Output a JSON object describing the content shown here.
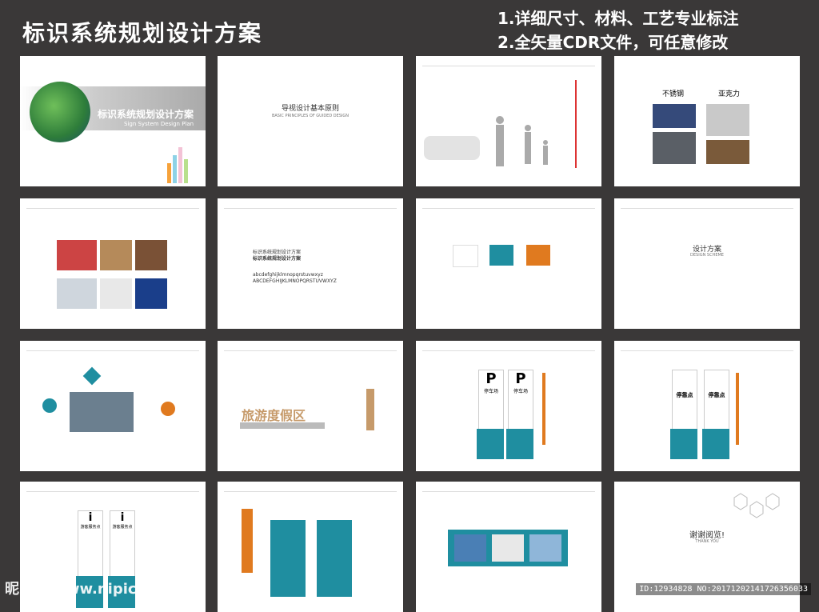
{
  "header": {
    "title": "标识系统规划设计方案",
    "note1": "1.详细尺寸、材料、工艺专业标注",
    "note2": "2.全矢量CDR文件，可任意修改"
  },
  "pages": {
    "p1": {
      "title_cn": "标识系统规划设计方案",
      "title_en": "Sign System Design Plan"
    },
    "p2": {
      "title_cn": "导视设计基本原则",
      "title_en": "BASIC PRINCIPLES OF GUIDED DESIGN"
    },
    "p4": {
      "label1": "不锈钢",
      "label2": "亚克力"
    },
    "p6": {
      "line1": "标识系统规划设计方案",
      "line2": "标识系统规划设计方案",
      "alphabet1": "abcdefghijklmnopqrstuvwxyz",
      "alphabet2": "ABCDEFGHIJKLMNOPQRSTUVWXYZ"
    },
    "p8": {
      "title_cn": "设计方案",
      "title_en": "DESIGN SCHEME"
    },
    "p10": {
      "logo_text": "旅游度假区"
    },
    "p11": {
      "sign1": "停车场",
      "sign2": "停车场"
    },
    "p12": {
      "sign1": "停靠点",
      "sign2": "停靠点"
    },
    "p13": {
      "sign1": "游客服务点",
      "sign2": "游客服务点"
    },
    "p16": {
      "title_cn": "谢谢阅览!",
      "title_en": "THANK YOU"
    }
  },
  "footer": {
    "watermark": "昵图网 www.nipic.com",
    "id_text": "ID:12934828 NO:20171202141726356033"
  },
  "colors": {
    "teal": "#1f8ea0",
    "orange": "#e07a1f",
    "background": "#3a3838"
  }
}
